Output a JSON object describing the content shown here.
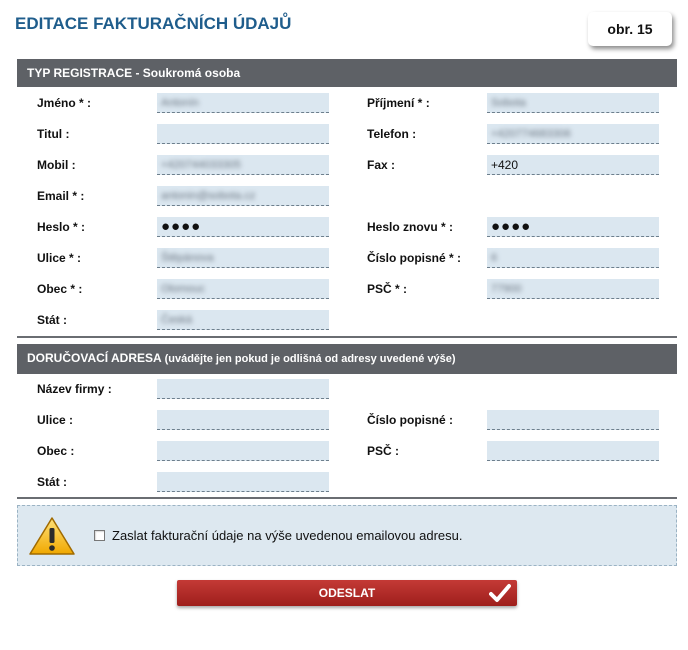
{
  "page": {
    "title": "EDITACE FAKTURAČNÍCH ÚDAJŮ",
    "figure_label": "obr. 15"
  },
  "registration": {
    "header": "TYP REGISTRACE - Soukromá osoba",
    "fields": {
      "jmeno": {
        "label": "Jméno * :",
        "value": "Antonín"
      },
      "prijmeni": {
        "label": "Příjmení * :",
        "value": "Sobota"
      },
      "titul": {
        "label": "Titul :",
        "value": ""
      },
      "telefon": {
        "label": "Telefon :",
        "value": "+420774683306"
      },
      "mobil": {
        "label": "Mobil :",
        "value": "+420744033305"
      },
      "fax": {
        "label": "Fax :",
        "value": "+420"
      },
      "email": {
        "label": "Email * :",
        "value": "antonin@sobota.cz"
      },
      "heslo": {
        "label": "Heslo * :",
        "value": "●●●●"
      },
      "heslo_znovu": {
        "label": "Heslo znovu * :",
        "value": "●●●●"
      },
      "ulice": {
        "label": "Ulice * :",
        "value": "Štěpánova"
      },
      "cislo": {
        "label": "Číslo popisné * :",
        "value": "6"
      },
      "obec": {
        "label": "Obec * :",
        "value": "Olomouc"
      },
      "psc": {
        "label": "PSČ * :",
        "value": "77900"
      },
      "stat": {
        "label": "Stát :",
        "value": "Česká"
      }
    }
  },
  "delivery": {
    "header": "DORUČOVACÍ ADRESA",
    "header_hint": "(uvádějte jen pokud je odlišná od adresy uvedené výše)",
    "fields": {
      "firma": {
        "label": "Název firmy :",
        "value": ""
      },
      "ulice": {
        "label": "Ulice :",
        "value": ""
      },
      "cislo": {
        "label": "Číslo popisné :",
        "value": ""
      },
      "obec": {
        "label": "Obec :",
        "value": ""
      },
      "psc": {
        "label": "PSČ :",
        "value": ""
      },
      "stat": {
        "label": "Stát :",
        "value": ""
      }
    }
  },
  "notice": {
    "icon": "warning-icon",
    "checkbox_label": "Zaslat fakturační údaje na výše uvedenou emailovou adresu.",
    "checked": false
  },
  "submit": {
    "label": "ODESLAT",
    "icon": "checkmark-icon"
  },
  "colors": {
    "title": "#1f5d8c",
    "section_bar": "#5e6166",
    "field_bg": "#dbe7f0",
    "notice_bg": "#dde8f0",
    "button": "#b02b27"
  }
}
